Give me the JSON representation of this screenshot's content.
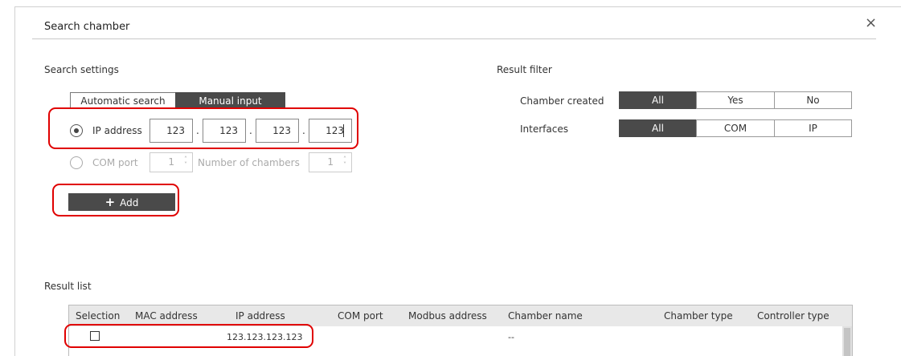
{
  "dialog": {
    "title": "Search chamber",
    "close_glyph": "×"
  },
  "search_settings": {
    "label": "Search settings",
    "tabs": [
      "Automatic search",
      "Manual input"
    ],
    "ip_option_label": "IP address",
    "ip_octets": [
      "123",
      "123",
      "123",
      "123"
    ],
    "ip_separator": ".",
    "com_option_label": "COM port",
    "com_port_value": "1",
    "chambers_label": "Number of chambers",
    "chambers_value": "1",
    "spin_up": "˄",
    "spin_down": "˅",
    "add_button": {
      "icon": "plus-icon",
      "glyph": "+",
      "label": "Add"
    }
  },
  "result_filter": {
    "label": "Result filter",
    "chamber_created": {
      "label": "Chamber created",
      "options": [
        "All",
        "Yes",
        "No"
      ],
      "selected": "All"
    },
    "interfaces": {
      "label": "Interfaces",
      "options": [
        "All",
        "COM",
        "IP"
      ],
      "selected": "All"
    }
  },
  "result_list": {
    "label": "Result list",
    "columns": [
      "Selection",
      "MAC address",
      "IP address",
      "COM port",
      "Modbus address",
      "Chamber name",
      "Chamber type",
      "Controller type"
    ],
    "rows": [
      {
        "selection": false,
        "mac": "",
        "ip": "123.123.123.123",
        "com_port": "",
        "modbus": "",
        "chamber_name": "--",
        "chamber_type": "",
        "controller_type": ""
      }
    ]
  },
  "colors": {
    "accent_dark": "#4a4a4a",
    "highlight_red": "#e00000"
  }
}
